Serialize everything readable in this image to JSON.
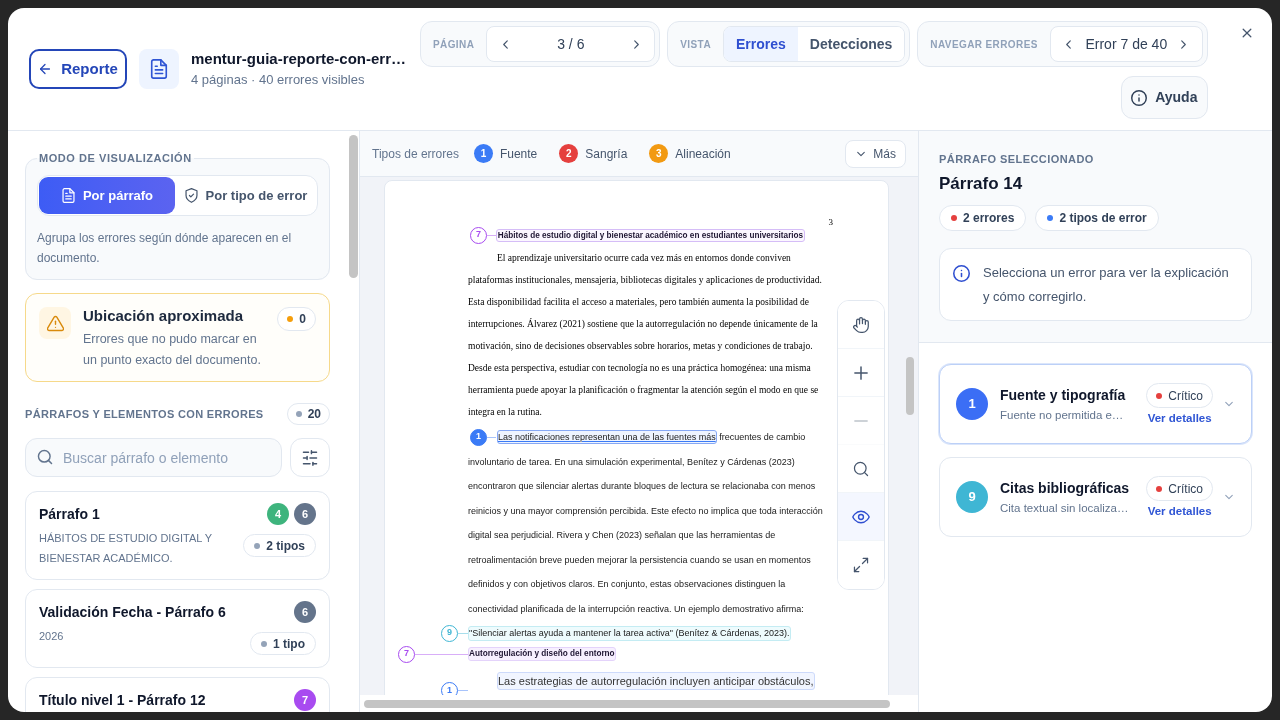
{
  "header": {
    "back_button": "Reporte",
    "file": {
      "title": "mentur-guia-reporte-con-err…",
      "meta": "4 páginas · 40 errores visibles"
    },
    "page_nav": {
      "label": "PÁGINA",
      "value": "3 / 6"
    },
    "view": {
      "label": "VISTA",
      "options": [
        {
          "label": "Errores",
          "selected": true
        },
        {
          "label": "Detecciones",
          "selected": false
        }
      ]
    },
    "error_nav": {
      "label": "NAVEGAR ERRORES",
      "value": "Error 7 de 40"
    },
    "help_button": "Ayuda"
  },
  "sidebar": {
    "mode": {
      "label": "MODO DE VISUALIZACIÓN",
      "options": [
        {
          "label": "Por párrafo",
          "selected": true
        },
        {
          "label": "Por tipo de error",
          "selected": false
        }
      ],
      "description": "Agrupa los errores según dónde aparecen en el documento."
    },
    "approx_location": {
      "title": "Ubicación aproximada",
      "description": "Errores que no pudo marcar en un punto exacto del documento.",
      "count": "0"
    },
    "list": {
      "title": "PÁRRAFOS Y ELEMENTOS CON ERRORES",
      "count": "20",
      "search": {
        "placeholder": "Buscar párrafo o elemento"
      },
      "items": [
        {
          "title": "Párrafo 1",
          "subtitle": "HÁBITOS DE ESTUDIO DIGITAL Y BIENESTAR ACADÉMICO.",
          "badges": [
            {
              "text": "4",
              "color": "#3eb47d"
            },
            {
              "text": "6",
              "color": "#64748b"
            }
          ],
          "types": "2 tipos"
        },
        {
          "title": "Validación Fecha - Párrafo 6",
          "subtitle": "2026",
          "badges": [
            {
              "text": "6",
              "color": "#64748b"
            }
          ],
          "types": "1 tipo"
        },
        {
          "title": "Título nivel 1 - Párrafo 12",
          "badges": [
            {
              "text": "7",
              "color": "#a84bf0"
            }
          ]
        }
      ]
    }
  },
  "viewer": {
    "legend": {
      "label": "Tipos de errores",
      "types": [
        {
          "number": "1",
          "name": "Fuente",
          "color": "#3b7bf6"
        },
        {
          "number": "2",
          "name": "Sangría",
          "color": "#e5403e"
        },
        {
          "number": "3",
          "name": "Alineación",
          "color": "#f29a12"
        }
      ],
      "more_button": "Más"
    },
    "page": {
      "number": "3",
      "blocks": [
        {
          "kind": "title",
          "marker": {
            "number": "7",
            "color": "#a84bf0",
            "selected": false
          },
          "text": "Hábitos de estudio digital y bienestar académico en estudiantes universitarios"
        },
        {
          "kind": "serif",
          "lines": [
            "El aprendizaje universitario ocurre cada vez más en entornos donde conviven",
            "plataformas institucionales, mensajeria, bibliotecas digitales y aplicaciones de productividad.",
            "Esta disponibilidad facilita el acceso a materiales, pero también aumenta la posibilidad de",
            "interrupciones. Álvarez (2021) sostiene que la autorregulación no depende únicamente de la",
            "motivación, sino de decisiones observables sobre horarios, metas y condiciones de trabajo.",
            "Desde esta perspectiva, estudiar con tecnología no es una práctica homogénea: una misma",
            "herramienta puede apoyar la planificación o fragmentar la atención según el modo en que se",
            "integra en la rutina."
          ]
        },
        {
          "kind": "comic",
          "marker": {
            "number": "1",
            "color": "#3b7bf6",
            "selected": true
          },
          "highlight": "Las notificaciones representan una de las fuentes más",
          "lines": [
            "frecuentes de cambio",
            "involuntario de tarea. En una simulación experimental, Benítez y Cárdenas (2023)",
            "encontraron que silenciar alertas durante bloques de lectura se relacionaba con menos",
            "reinicios y una mayor comprensión percibida. Este efecto no implica que toda interacción",
            "digital sea perjudicial. Rivera y Chen (2023) señalan que las herramientas de",
            "retroalimentación breve pueden mejorar la persistencia cuando se usan en momentos",
            "definidos y con objetivos claros. En conjunto, estas observaciones distinguen la",
            "conectividad planificada de la interrupción reactiva. Un ejemplo demostrativo afirma:"
          ]
        },
        {
          "kind": "quote",
          "marker": {
            "number": "9",
            "color": "#3fb6d4",
            "selected": false
          },
          "text": "\"Silenciar alertas ayuda a mantener la tarea activa\" (Benítez & Cárdenas, 2023)."
        },
        {
          "kind": "heading",
          "marker": {
            "number": "7",
            "color": "#a84bf0",
            "selected": false
          },
          "text": "Autorregulación y diseño del entorno"
        },
        {
          "kind": "sans",
          "marker": {
            "number": "1",
            "color": "#3b7bf6",
            "selected": false
          },
          "text": "Las estrategias de autorregulación incluyen anticipar obstáculos,"
        }
      ]
    },
    "tools": [
      {
        "kind": "hand",
        "selected": false,
        "disabled": false
      },
      {
        "kind": "zoom_in",
        "selected": false,
        "disabled": false
      },
      {
        "kind": "zoom_out",
        "selected": false,
        "disabled": true
      },
      {
        "kind": "search",
        "selected": false,
        "disabled": false
      },
      {
        "kind": "visibility",
        "selected": true,
        "disabled": false
      },
      {
        "kind": "fullscreen",
        "selected": false,
        "disabled": false
      }
    ]
  },
  "selection": {
    "label": "PÁRRAFO SELECCIONADO",
    "title": "Párrafo 14",
    "stats": [
      {
        "text": "2 errores",
        "color": "#e5403e"
      },
      {
        "text": "2 tipos de error",
        "color": "#3b7bf6"
      }
    ],
    "hint": "Selecciona un error para ver la explicación y cómo corregirlo."
  },
  "errors": [
    {
      "number": "1",
      "color": "#3b6ef5",
      "title": "Fuente y tipografía",
      "description": "Fuente no permitida e…",
      "severity": "Crítico",
      "link": "Ver detalles",
      "selected": true
    },
    {
      "number": "9",
      "color": "#3fb6d4",
      "title": "Citas bibliográficas",
      "description": "Cita textual sin localiza…",
      "severity": "Crítico",
      "link": "Ver detalles",
      "selected": false
    }
  ]
}
